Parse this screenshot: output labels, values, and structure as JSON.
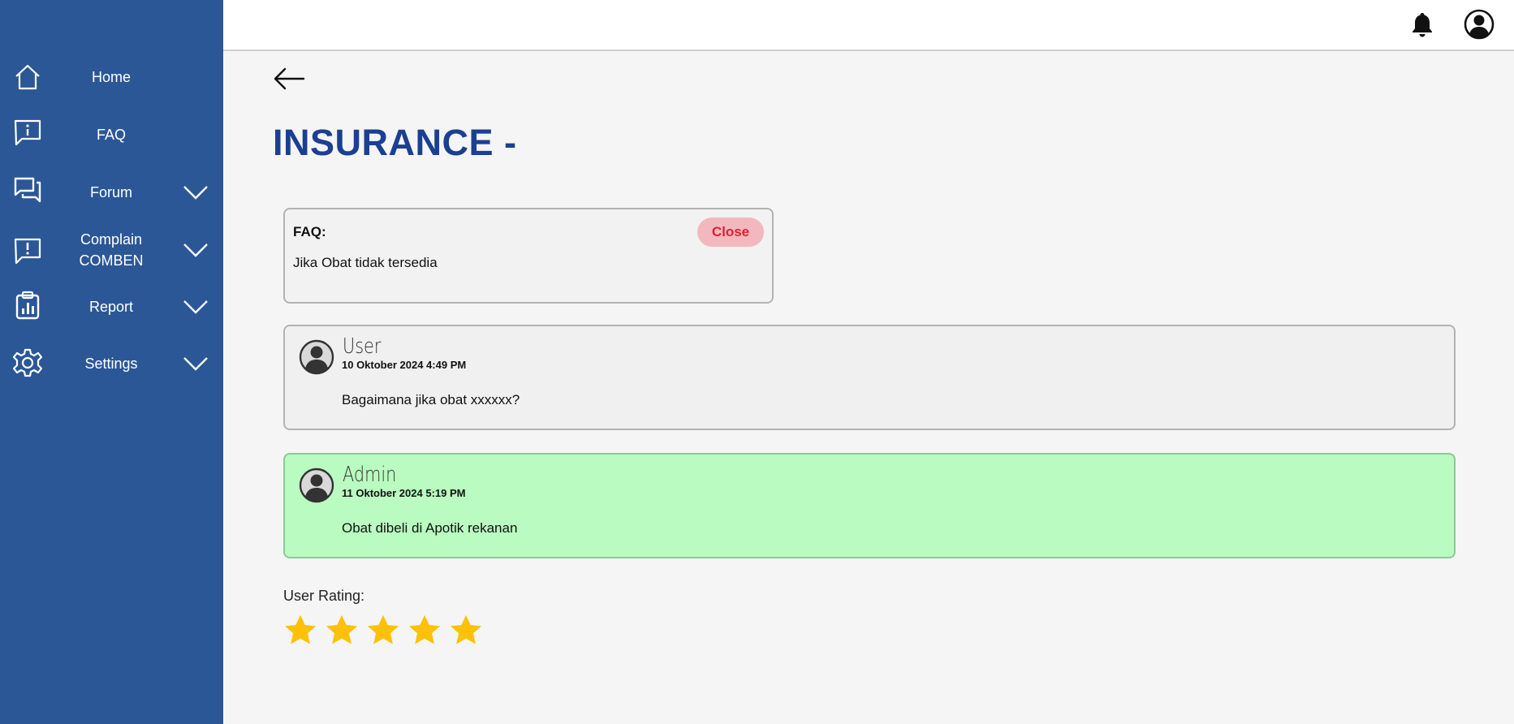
{
  "sidebar": {
    "items": [
      {
        "label": "Home",
        "icon": "home-icon",
        "has_submenu": false
      },
      {
        "label": "FAQ",
        "icon": "faq-icon",
        "has_submenu": false
      },
      {
        "label": "Forum",
        "icon": "forum-icon",
        "has_submenu": true
      },
      {
        "label_line1": "Complain",
        "label_line2": "COMBEN",
        "icon": "complain-icon",
        "has_submenu": true
      },
      {
        "label": "Report",
        "icon": "report-icon",
        "has_submenu": true
      },
      {
        "label": "Settings",
        "icon": "gear-icon",
        "has_submenu": true
      }
    ],
    "background_color": "#2b5797"
  },
  "header": {
    "notification_icon": "bell-icon",
    "profile_icon": "user-avatar-icon"
  },
  "page": {
    "back_icon": "arrow-left-icon",
    "title": "INSURANCE -",
    "title_color": "#1b3f93"
  },
  "faq": {
    "heading": "FAQ:",
    "question": "Jika Obat tidak tersedia",
    "close_label": "Close"
  },
  "messages": [
    {
      "author": "User",
      "timestamp": "10 Oktober 2024 4:49 PM",
      "text": "Bagaimana jika obat xxxxxx?",
      "bg_color": "#f0f0f0"
    },
    {
      "author": "Admin",
      "timestamp": "11 Oktober 2024 5:19 PM",
      "text": "Obat dibeli di Apotik rekanan",
      "bg_color": "#b9fbc0"
    }
  ],
  "rating": {
    "label": "User Rating:",
    "value": 5,
    "max": 5,
    "star_color": "#ffc107"
  }
}
